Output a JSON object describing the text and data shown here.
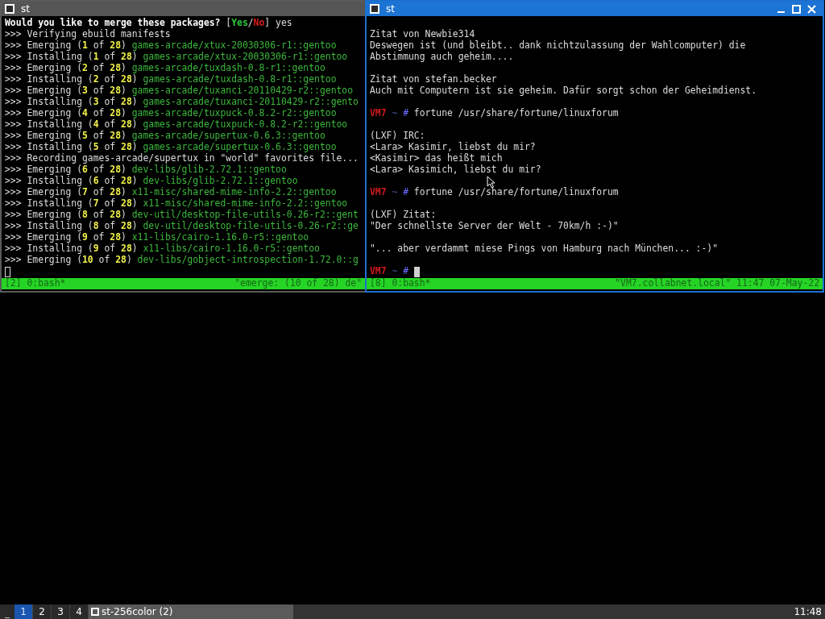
{
  "windows": [
    {
      "title": "st",
      "active": false,
      "status": {
        "left": "[2] 0:bash*",
        "right": "\"emerge: (10 of 28) de\""
      },
      "lines": [
        {
          "kind": "text",
          "segments": [
            {
              "kind": "bold",
              "text": "Would you like to merge these packages? "
            },
            {
              "kind": "plain",
              "text": "["
            },
            {
              "kind": "yes",
              "text": "Yes"
            },
            {
              "kind": "plain",
              "text": "/"
            },
            {
              "kind": "no",
              "text": "No"
            },
            {
              "kind": "plain",
              "text": "] yes"
            }
          ]
        },
        {
          "kind": "text",
          "segments": [
            {
              "kind": "plain",
              "text": ">>> Verifying ebuild manifests"
            }
          ]
        },
        {
          "kind": "text",
          "segments": [
            {
              "kind": "plain",
              "text": ">>> Emerging ("
            },
            {
              "kind": "num",
              "text": "1"
            },
            {
              "kind": "plain",
              "text": " of "
            },
            {
              "kind": "num",
              "text": "28"
            },
            {
              "kind": "plain",
              "text": ") "
            },
            {
              "kind": "pkg",
              "text": "games-arcade/xtux-20030306-r1::gentoo"
            }
          ]
        },
        {
          "kind": "text",
          "segments": [
            {
              "kind": "plain",
              "text": ">>> Installing ("
            },
            {
              "kind": "num",
              "text": "1"
            },
            {
              "kind": "plain",
              "text": " of "
            },
            {
              "kind": "num",
              "text": "28"
            },
            {
              "kind": "plain",
              "text": ") "
            },
            {
              "kind": "pkg",
              "text": "games-arcade/xtux-20030306-r1::gentoo"
            }
          ]
        },
        {
          "kind": "text",
          "segments": [
            {
              "kind": "plain",
              "text": ">>> Emerging ("
            },
            {
              "kind": "num",
              "text": "2"
            },
            {
              "kind": "plain",
              "text": " of "
            },
            {
              "kind": "num",
              "text": "28"
            },
            {
              "kind": "plain",
              "text": ") "
            },
            {
              "kind": "pkg",
              "text": "games-arcade/tuxdash-0.8-r1::gentoo"
            }
          ]
        },
        {
          "kind": "text",
          "segments": [
            {
              "kind": "plain",
              "text": ">>> Installing ("
            },
            {
              "kind": "num",
              "text": "2"
            },
            {
              "kind": "plain",
              "text": " of "
            },
            {
              "kind": "num",
              "text": "28"
            },
            {
              "kind": "plain",
              "text": ") "
            },
            {
              "kind": "pkg",
              "text": "games-arcade/tuxdash-0.8-r1::gentoo"
            }
          ]
        },
        {
          "kind": "text",
          "segments": [
            {
              "kind": "plain",
              "text": ">>> Emerging ("
            },
            {
              "kind": "num",
              "text": "3"
            },
            {
              "kind": "plain",
              "text": " of "
            },
            {
              "kind": "num",
              "text": "28"
            },
            {
              "kind": "plain",
              "text": ") "
            },
            {
              "kind": "pkg",
              "text": "games-arcade/tuxanci-20110429-r2::gentoo"
            }
          ]
        },
        {
          "kind": "text",
          "segments": [
            {
              "kind": "plain",
              "text": ">>> Installing ("
            },
            {
              "kind": "num",
              "text": "3"
            },
            {
              "kind": "plain",
              "text": " of "
            },
            {
              "kind": "num",
              "text": "28"
            },
            {
              "kind": "plain",
              "text": ") "
            },
            {
              "kind": "pkg",
              "text": "games-arcade/tuxanci-20110429-r2::gento"
            }
          ]
        },
        {
          "kind": "text",
          "segments": [
            {
              "kind": "plain",
              "text": ">>> Emerging ("
            },
            {
              "kind": "num",
              "text": "4"
            },
            {
              "kind": "plain",
              "text": " of "
            },
            {
              "kind": "num",
              "text": "28"
            },
            {
              "kind": "plain",
              "text": ") "
            },
            {
              "kind": "pkg",
              "text": "games-arcade/tuxpuck-0.8.2-r2::gentoo"
            }
          ]
        },
        {
          "kind": "text",
          "segments": [
            {
              "kind": "plain",
              "text": ">>> Installing ("
            },
            {
              "kind": "num",
              "text": "4"
            },
            {
              "kind": "plain",
              "text": " of "
            },
            {
              "kind": "num",
              "text": "28"
            },
            {
              "kind": "plain",
              "text": ") "
            },
            {
              "kind": "pkg",
              "text": "games-arcade/tuxpuck-0.8.2-r2::gentoo"
            }
          ]
        },
        {
          "kind": "text",
          "segments": [
            {
              "kind": "plain",
              "text": ">>> Emerging ("
            },
            {
              "kind": "num",
              "text": "5"
            },
            {
              "kind": "plain",
              "text": " of "
            },
            {
              "kind": "num",
              "text": "28"
            },
            {
              "kind": "plain",
              "text": ") "
            },
            {
              "kind": "pkg",
              "text": "games-arcade/supertux-0.6.3::gentoo"
            }
          ]
        },
        {
          "kind": "text",
          "segments": [
            {
              "kind": "plain",
              "text": ">>> Installing ("
            },
            {
              "kind": "num",
              "text": "5"
            },
            {
              "kind": "plain",
              "text": " of "
            },
            {
              "kind": "num",
              "text": "28"
            },
            {
              "kind": "plain",
              "text": ") "
            },
            {
              "kind": "pkg",
              "text": "games-arcade/supertux-0.6.3::gentoo"
            }
          ]
        },
        {
          "kind": "text",
          "segments": [
            {
              "kind": "plain",
              "text": ">>> Recording games-arcade/supertux in \"world\" favorites file..."
            }
          ]
        },
        {
          "kind": "text",
          "segments": [
            {
              "kind": "plain",
              "text": ">>> Emerging ("
            },
            {
              "kind": "num",
              "text": "6"
            },
            {
              "kind": "plain",
              "text": " of "
            },
            {
              "kind": "num",
              "text": "28"
            },
            {
              "kind": "plain",
              "text": ") "
            },
            {
              "kind": "pkg",
              "text": "dev-libs/glib-2.72.1::gentoo"
            }
          ]
        },
        {
          "kind": "text",
          "segments": [
            {
              "kind": "plain",
              "text": ">>> Installing ("
            },
            {
              "kind": "num",
              "text": "6"
            },
            {
              "kind": "plain",
              "text": " of "
            },
            {
              "kind": "num",
              "text": "28"
            },
            {
              "kind": "plain",
              "text": ") "
            },
            {
              "kind": "pkg",
              "text": "dev-libs/glib-2.72.1::gentoo"
            }
          ]
        },
        {
          "kind": "text",
          "segments": [
            {
              "kind": "plain",
              "text": ">>> Emerging ("
            },
            {
              "kind": "num",
              "text": "7"
            },
            {
              "kind": "plain",
              "text": " of "
            },
            {
              "kind": "num",
              "text": "28"
            },
            {
              "kind": "plain",
              "text": ") "
            },
            {
              "kind": "pkg",
              "text": "x11-misc/shared-mime-info-2.2::gentoo"
            }
          ]
        },
        {
          "kind": "text",
          "segments": [
            {
              "kind": "plain",
              "text": ">>> Installing ("
            },
            {
              "kind": "num",
              "text": "7"
            },
            {
              "kind": "plain",
              "text": " of "
            },
            {
              "kind": "num",
              "text": "28"
            },
            {
              "kind": "plain",
              "text": ") "
            },
            {
              "kind": "pkg",
              "text": "x11-misc/shared-mime-info-2.2::gentoo"
            }
          ]
        },
        {
          "kind": "text",
          "segments": [
            {
              "kind": "plain",
              "text": ">>> Emerging ("
            },
            {
              "kind": "num",
              "text": "8"
            },
            {
              "kind": "plain",
              "text": " of "
            },
            {
              "kind": "num",
              "text": "28"
            },
            {
              "kind": "plain",
              "text": ") "
            },
            {
              "kind": "pkg",
              "text": "dev-util/desktop-file-utils-0.26-r2::gent"
            }
          ]
        },
        {
          "kind": "text",
          "segments": [
            {
              "kind": "plain",
              "text": ">>> Installing ("
            },
            {
              "kind": "num",
              "text": "8"
            },
            {
              "kind": "plain",
              "text": " of "
            },
            {
              "kind": "num",
              "text": "28"
            },
            {
              "kind": "plain",
              "text": ") "
            },
            {
              "kind": "pkg",
              "text": "dev-util/desktop-file-utils-0.26-r2::ge"
            }
          ]
        },
        {
          "kind": "text",
          "segments": [
            {
              "kind": "plain",
              "text": ">>> Emerging ("
            },
            {
              "kind": "num",
              "text": "9"
            },
            {
              "kind": "plain",
              "text": " of "
            },
            {
              "kind": "num",
              "text": "28"
            },
            {
              "kind": "plain",
              "text": ") "
            },
            {
              "kind": "pkg",
              "text": "x11-libs/cairo-1.16.0-r5::gentoo"
            }
          ]
        },
        {
          "kind": "text",
          "segments": [
            {
              "kind": "plain",
              "text": ">>> Installing ("
            },
            {
              "kind": "num",
              "text": "9"
            },
            {
              "kind": "plain",
              "text": " of "
            },
            {
              "kind": "num",
              "text": "28"
            },
            {
              "kind": "plain",
              "text": ") "
            },
            {
              "kind": "pkg",
              "text": "x11-libs/cairo-1.16.0-r5::gentoo"
            }
          ]
        },
        {
          "kind": "text",
          "segments": [
            {
              "kind": "plain",
              "text": ">>> Emerging ("
            },
            {
              "kind": "num",
              "text": "10"
            },
            {
              "kind": "plain",
              "text": " of "
            },
            {
              "kind": "num",
              "text": "28"
            },
            {
              "kind": "plain",
              "text": ") "
            },
            {
              "kind": "pkg",
              "text": "dev-libs/gobject-introspection-1.72.0::g"
            }
          ]
        },
        {
          "kind": "text",
          "segments": [
            {
              "kind": "cursor-hollow"
            }
          ]
        }
      ]
    },
    {
      "title": "st",
      "active": true,
      "status": {
        "left": "[8] 0:bash*",
        "right": "\"VM7.collabnet.local\" 11:47 07-May-22"
      },
      "lines": [
        {
          "kind": "blank"
        },
        {
          "kind": "text",
          "segments": [
            {
              "kind": "plain",
              "text": "Zitat von Newbie314"
            }
          ]
        },
        {
          "kind": "text",
          "segments": [
            {
              "kind": "plain",
              "text": "Deswegen ist (und bleibt.. dank nichtzulassung der Wahlcomputer) die"
            }
          ]
        },
        {
          "kind": "text",
          "segments": [
            {
              "kind": "plain",
              "text": "Abstimmung auch geheim...."
            }
          ]
        },
        {
          "kind": "blank"
        },
        {
          "kind": "text",
          "segments": [
            {
              "kind": "plain",
              "text": "Zitat von stefan.becker"
            }
          ]
        },
        {
          "kind": "text",
          "segments": [
            {
              "kind": "plain",
              "text": "Auch mit Computern ist sie geheim. Dafür sorgt schon der Geheimdienst."
            }
          ]
        },
        {
          "kind": "blank"
        },
        {
          "kind": "text",
          "segments": [
            {
              "kind": "host",
              "text": "VM7"
            },
            {
              "kind": "tilde",
              "text": " ~"
            },
            {
              "kind": "hash",
              "text": " #"
            },
            {
              "kind": "plain",
              "text": " fortune /usr/share/fortune/linuxforum"
            }
          ]
        },
        {
          "kind": "blank"
        },
        {
          "kind": "text",
          "segments": [
            {
              "kind": "plain",
              "text": "(LXF) IRC:"
            }
          ]
        },
        {
          "kind": "text",
          "segments": [
            {
              "kind": "plain",
              "text": "<Lara> Kasimir, liebst du mir?"
            }
          ]
        },
        {
          "kind": "text",
          "segments": [
            {
              "kind": "plain",
              "text": "<Kasimir> das heißt mich"
            }
          ]
        },
        {
          "kind": "text",
          "segments": [
            {
              "kind": "plain",
              "text": "<Lara> Kasimich, liebst du mir?"
            }
          ]
        },
        {
          "kind": "blank"
        },
        {
          "kind": "text",
          "segments": [
            {
              "kind": "host",
              "text": "VM7"
            },
            {
              "kind": "tilde",
              "text": " ~"
            },
            {
              "kind": "hash",
              "text": " #"
            },
            {
              "kind": "plain",
              "text": " fortune /usr/share/fortune/linuxforum"
            }
          ]
        },
        {
          "kind": "blank"
        },
        {
          "kind": "text",
          "segments": [
            {
              "kind": "plain",
              "text": "(LXF) Zitat:"
            }
          ]
        },
        {
          "kind": "text",
          "segments": [
            {
              "kind": "plain",
              "text": "\"Der schnellste Server der Welt - 70km/h :-)\""
            }
          ]
        },
        {
          "kind": "blank"
        },
        {
          "kind": "text",
          "segments": [
            {
              "kind": "plain",
              "text": "\"... aber verdammt miese Pings von Hamburg nach München... :-)\""
            }
          ]
        },
        {
          "kind": "blank"
        },
        {
          "kind": "text",
          "segments": [
            {
              "kind": "host",
              "text": "VM7"
            },
            {
              "kind": "tilde",
              "text": " ~"
            },
            {
              "kind": "hash",
              "text": " #"
            },
            {
              "kind": "cursor-block"
            }
          ]
        }
      ]
    }
  ],
  "taskbar": {
    "desktop_button": "_",
    "workspaces": [
      {
        "label": "1",
        "selected": true
      },
      {
        "label": "2",
        "selected": false
      },
      {
        "label": "3",
        "selected": false
      },
      {
        "label": "4",
        "selected": false
      }
    ],
    "task": "st-256color (2)",
    "clock": "11:48"
  }
}
